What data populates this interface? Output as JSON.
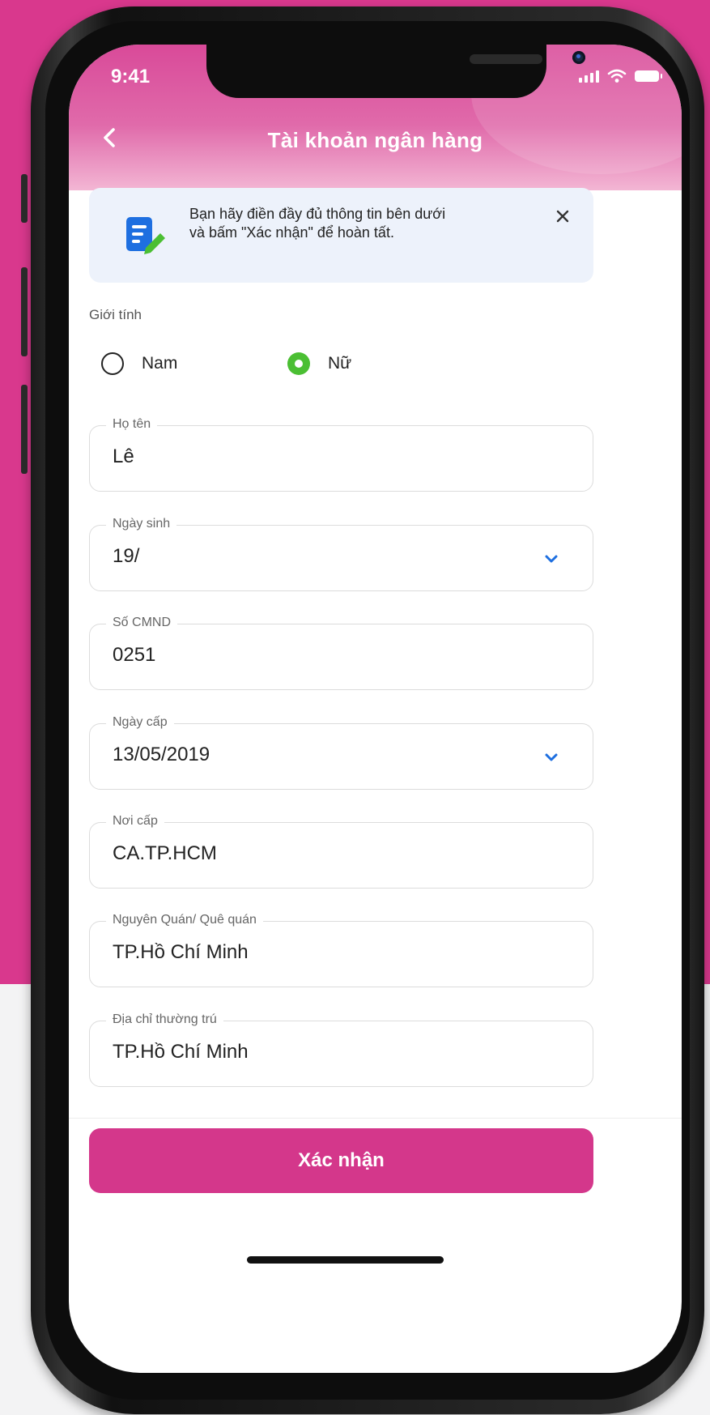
{
  "status_bar": {
    "time": "9:41"
  },
  "header": {
    "title": "Tài khoản ngân hàng"
  },
  "notice": {
    "line1": "Bạn hãy điền đầy đủ thông tin bên dưới",
    "line2": "và bấm \"Xác nhận\" để hoàn tất."
  },
  "gender": {
    "label": "Giới tính",
    "options": [
      {
        "label": "Nam",
        "selected": false
      },
      {
        "label": "Nữ",
        "selected": true
      }
    ]
  },
  "fields": {
    "full_name": {
      "label": "Họ tên",
      "value": "Lê"
    },
    "birth_date": {
      "label": "Ngày sinh",
      "value": "19/"
    },
    "id_number": {
      "label": "Số CMND",
      "value": "0251"
    },
    "issue_date": {
      "label": "Ngày cấp",
      "value": "13/05/2019"
    },
    "issue_place": {
      "label": "Nơi cấp",
      "value": "CA.TP.HCM"
    },
    "hometown": {
      "label": "Nguyên Quán/ Quê quán",
      "value": "TP.Hồ Chí Minh"
    },
    "address": {
      "label": "Địa chỉ thường trú",
      "value": "TP.Hồ Chí Minh"
    }
  },
  "confirm_button": {
    "label": "Xác nhận"
  },
  "colors": {
    "brand": "#d4378b",
    "background": "#d9388d",
    "radio_selected": "#4bbf33",
    "chevron": "#1e6fe0"
  },
  "icons": [
    "back-arrow-icon",
    "edit-document-icon",
    "close-icon",
    "chevron-down-icon",
    "signal-icon",
    "wifi-icon",
    "battery-icon"
  ]
}
